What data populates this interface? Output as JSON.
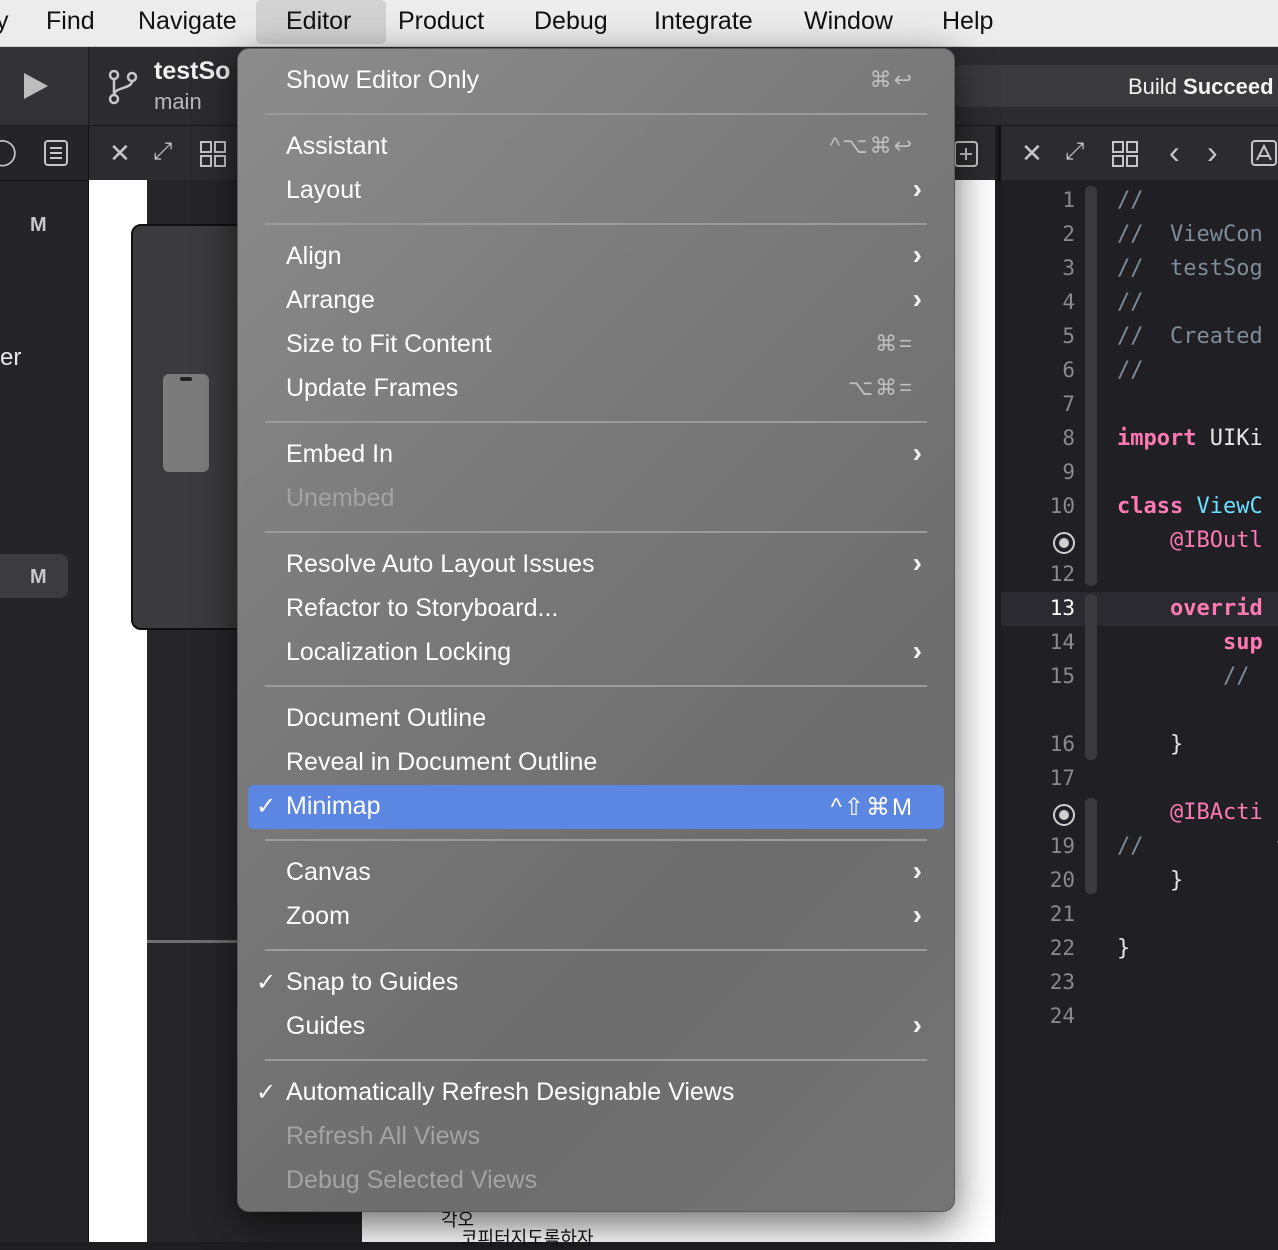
{
  "menubar": {
    "items": [
      {
        "label": "Find"
      },
      {
        "label": "Navigate"
      },
      {
        "label": "Editor"
      },
      {
        "label": "Product"
      },
      {
        "label": "Debug"
      },
      {
        "label": "Integrate"
      },
      {
        "label": "Window"
      },
      {
        "label": "Help"
      }
    ],
    "active": "Editor"
  },
  "toolbar": {
    "project": "testSo",
    "branch": "main",
    "status_prefix": "Build ",
    "status_bold": "Succeed"
  },
  "navigator": {
    "badge1": "M",
    "badge2": "M",
    "partial_text": "er"
  },
  "canvas": {
    "korean1": "각오",
    "korean2": "코피터지도록하자"
  },
  "code": {
    "lines": [
      {
        "n": "1",
        "text": "//"
      },
      {
        "n": "2",
        "text": "//  ViewCon"
      },
      {
        "n": "3",
        "text": "//  testSog"
      },
      {
        "n": "4",
        "text": "//"
      },
      {
        "n": "5",
        "text": "//  Created"
      },
      {
        "n": "6",
        "text": "//"
      },
      {
        "n": "7",
        "text": ""
      },
      {
        "n": "8",
        "kw": "import",
        "rest": " UIKi"
      },
      {
        "n": "9",
        "text": ""
      },
      {
        "n": "10",
        "kw": "class",
        "type": " ViewC"
      },
      {
        "n": "",
        "attr": "    @IBOutl"
      },
      {
        "n": "12",
        "text": ""
      },
      {
        "n": "13",
        "kw": "    overrid"
      },
      {
        "n": "14",
        "kw": "        sup"
      },
      {
        "n": "15",
        "text": "        //"
      },
      {
        "n": "16",
        "plain": "    }"
      },
      {
        "n": "17",
        "text": ""
      },
      {
        "n": "",
        "attr": "    @IBActi"
      },
      {
        "n": "19",
        "text": "//          v"
      },
      {
        "n": "20",
        "plain": "    }"
      },
      {
        "n": "21",
        "text": ""
      },
      {
        "n": "22",
        "plain": "}"
      },
      {
        "n": "23",
        "text": ""
      },
      {
        "n": "24",
        "text": ""
      }
    ],
    "current_line": "13"
  },
  "menu": {
    "title": "Editor",
    "items": [
      {
        "label": "Show Editor Only",
        "shortcut": "⌘↩"
      },
      {
        "label": "Assistant",
        "shortcut": "^⌥⌘↩"
      },
      {
        "label": "Layout",
        "submenu": true
      },
      {
        "label": "Align",
        "submenu": true
      },
      {
        "label": "Arrange",
        "submenu": true
      },
      {
        "label": "Size to Fit Content",
        "shortcut": "⌘="
      },
      {
        "label": "Update Frames",
        "shortcut": "⌥⌘="
      },
      {
        "label": "Embed In",
        "submenu": true
      },
      {
        "label": "Unembed",
        "disabled": true
      },
      {
        "label": "Resolve Auto Layout Issues",
        "submenu": true
      },
      {
        "label": "Refactor to Storyboard...",
        "submenu": false
      },
      {
        "label": "Localization Locking",
        "submenu": true
      },
      {
        "label": "Document Outline"
      },
      {
        "label": "Reveal in Document Outline"
      },
      {
        "label": "Minimap",
        "checked": true,
        "highlighted": true,
        "shortcut": "^⇧⌘M"
      },
      {
        "label": "Canvas",
        "submenu": true
      },
      {
        "label": "Zoom",
        "submenu": true
      },
      {
        "label": "Snap to Guides",
        "checked": true
      },
      {
        "label": "Guides",
        "submenu": true
      },
      {
        "label": "Automatically Refresh Designable Views",
        "checked": true
      },
      {
        "label": "Refresh All Views",
        "disabled": true
      },
      {
        "label": "Debug Selected Views",
        "disabled": true
      }
    ],
    "check_glyph": "✓",
    "arrow_glyph": "›"
  },
  "colors": {
    "highlight": "#5b86e1",
    "menubar": "#ececec",
    "keyword": "#ff7ab2",
    "type": "#6bdfff"
  }
}
